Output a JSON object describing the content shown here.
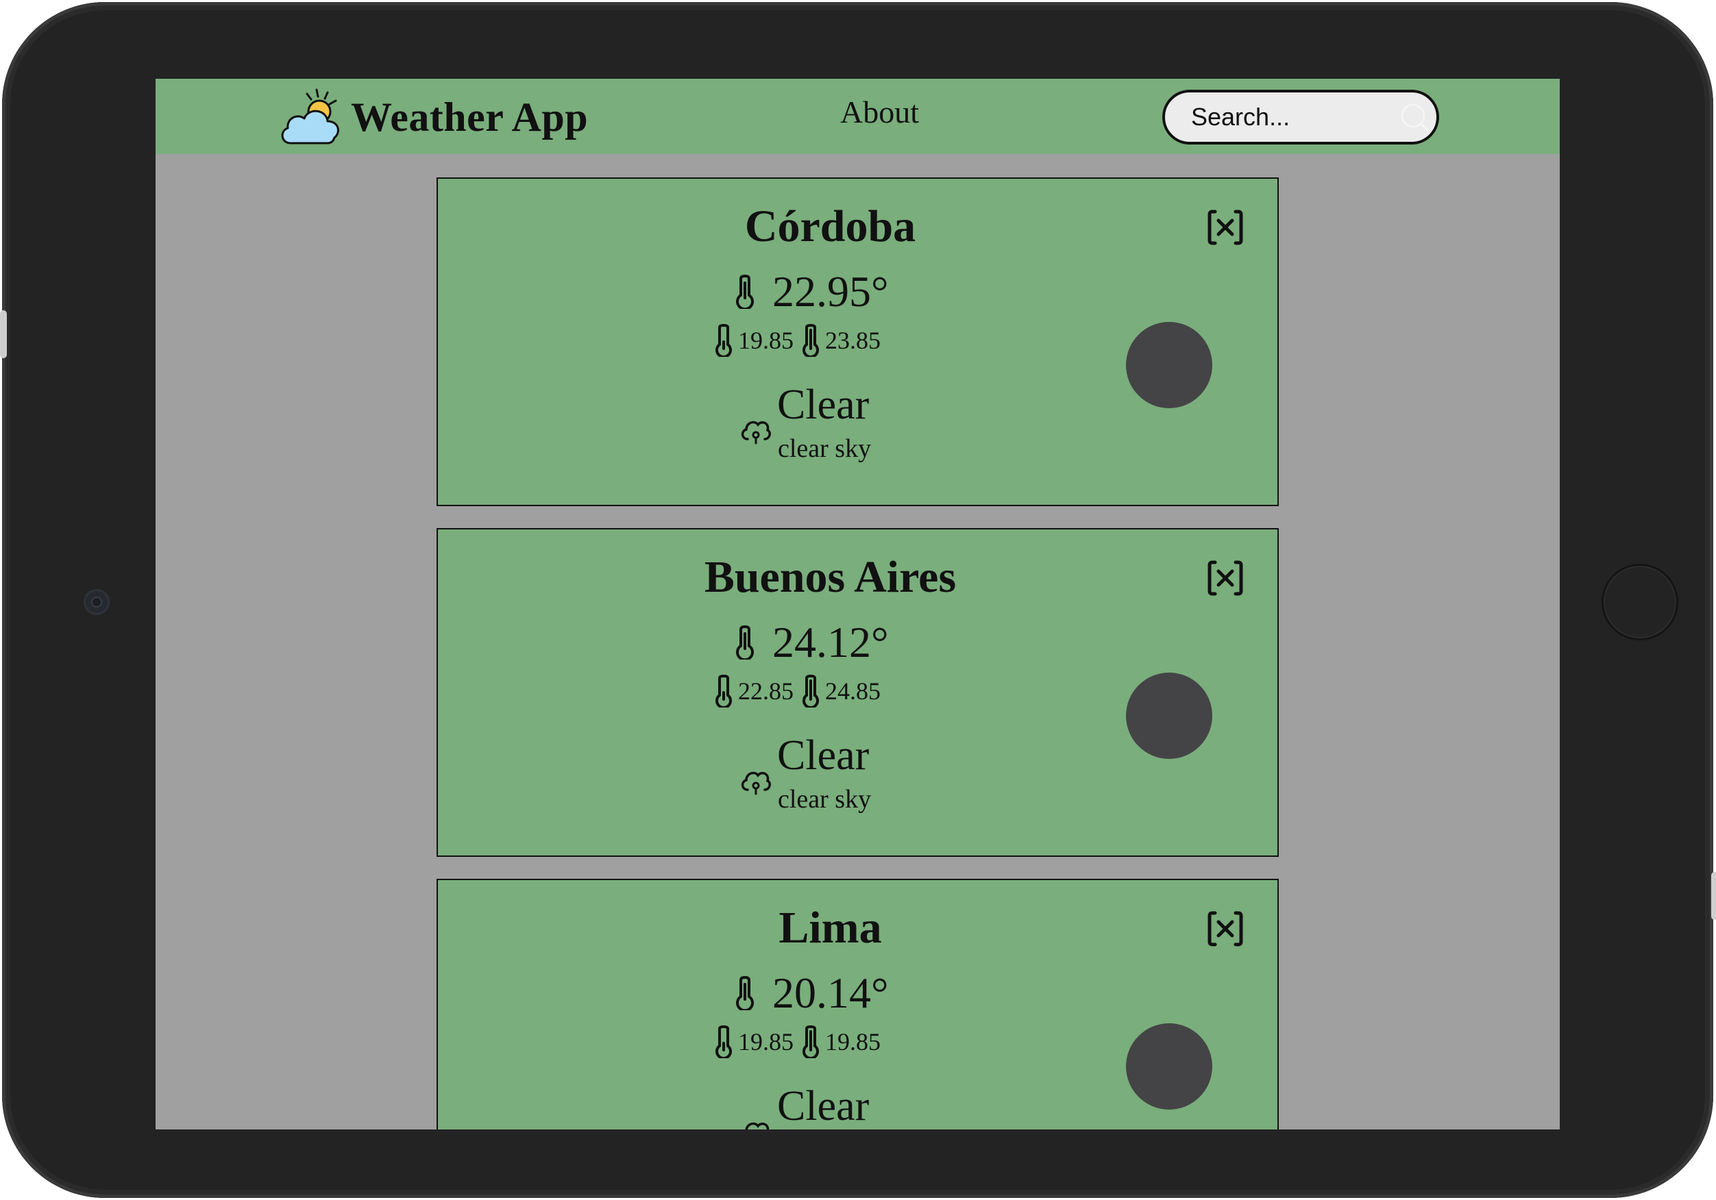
{
  "app": {
    "name": "Weather App",
    "logo_icon": "cloud-sun-icon"
  },
  "nav": {
    "about_label": "About"
  },
  "search": {
    "placeholder": "Search...",
    "icon": "search-icon"
  },
  "cards": [
    {
      "city": "Córdoba",
      "temp": "22.95°",
      "temp_min": "19.85",
      "temp_max": "23.85",
      "condition": "Clear",
      "description": "clear sky"
    },
    {
      "city": "Buenos Aires",
      "temp": "24.12°",
      "temp_min": "22.85",
      "temp_max": "24.85",
      "condition": "Clear",
      "description": "clear sky"
    },
    {
      "city": "Lima",
      "temp": "20.14°",
      "temp_min": "19.85",
      "temp_max": "19.85",
      "condition": "Clear",
      "description": ""
    }
  ],
  "icons": {
    "close": "close-x-icon",
    "thermometer": "thermometer-icon",
    "weather_condition": "cloud-icon"
  },
  "colors": {
    "nav_background": "#7aae7c",
    "card_background": "#7aae7c",
    "page_background": "#9fa09f",
    "device_frame": "#232323",
    "weather_image_placeholder": "#444446"
  }
}
